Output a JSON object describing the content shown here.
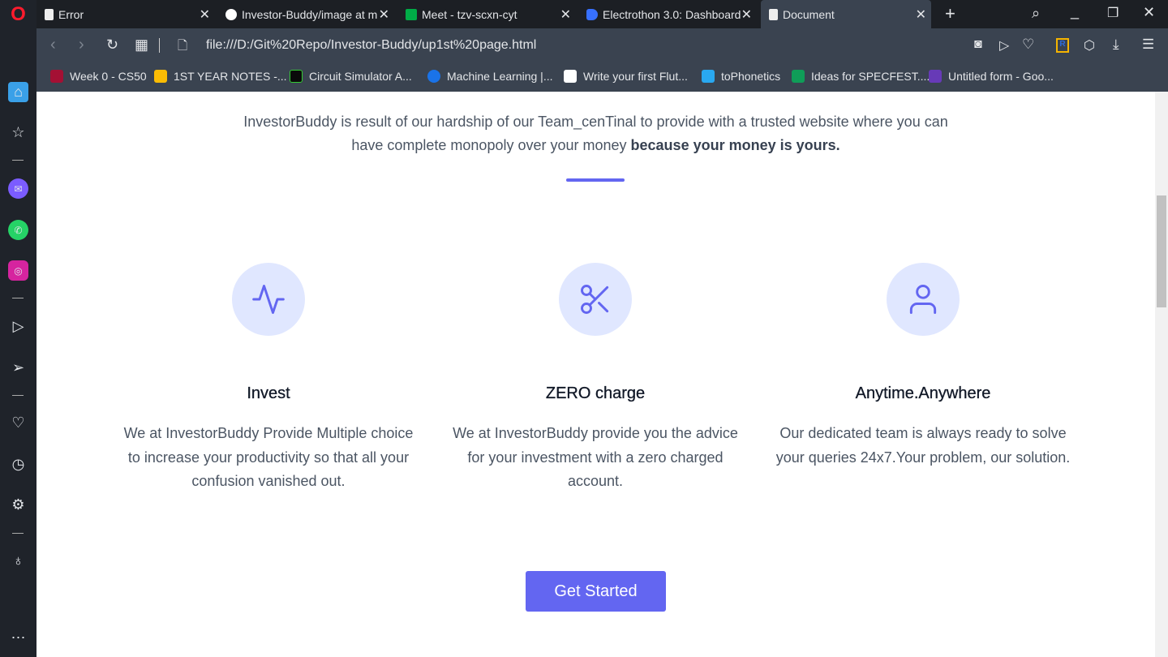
{
  "browser": {
    "tabs": [
      {
        "title": "Error",
        "icon": "page-icon"
      },
      {
        "title": "Investor-Buddy/image at m",
        "icon": "github-icon"
      },
      {
        "title": "Meet - tzv-scxn-cyt",
        "icon": "meet-icon"
      },
      {
        "title": "Electrothon 3.0: Dashboard",
        "icon": "devfolio-icon"
      },
      {
        "title": "Document",
        "icon": "page-icon",
        "active": true
      }
    ],
    "url": "file:///D:/Git%20Repo/Investor-Buddy/up1st%20page.html",
    "bookmarks": [
      {
        "label": "Week 0 - CS50",
        "color": "#a41034"
      },
      {
        "label": "1ST YEAR NOTES -...",
        "color": "#fbbc04"
      },
      {
        "label": "Circuit Simulator A...",
        "color": "#0a0a0a"
      },
      {
        "label": "Machine Learning |...",
        "color": "#1a73e8"
      },
      {
        "label": "Write your first Flut...",
        "color": "#ffffff"
      },
      {
        "label": "toPhonetics",
        "color": "#29a8f0"
      },
      {
        "label": "Ideas for SPECFEST....",
        "color": "#0f9d58"
      },
      {
        "label": "Untitled form - Goo...",
        "color": "#673ab7"
      }
    ]
  },
  "page": {
    "intro": "InvestorBuddy is result of our hardship of our Team_cenTinal to provide with a trusted website where you can have complete monopoly over your money ",
    "intro_bold": "because your money is yours.",
    "features": [
      {
        "title": "Invest",
        "icon": "activity-icon",
        "text": "We at InvestorBuddy Provide Multiple choice to increase your productivity so that all your confusion vanished out."
      },
      {
        "title": "ZERO charge",
        "icon": "scissors-icon",
        "text": "We at InvestorBuddy provide you the advice for your investment with a zero charged account."
      },
      {
        "title": "Anytime.Anywhere",
        "icon": "user-icon",
        "text": "Our dedicated team is always ready to solve your queries 24x7.Your problem, our solution."
      }
    ],
    "cta": "Get Started",
    "accent": "#6366f1"
  }
}
